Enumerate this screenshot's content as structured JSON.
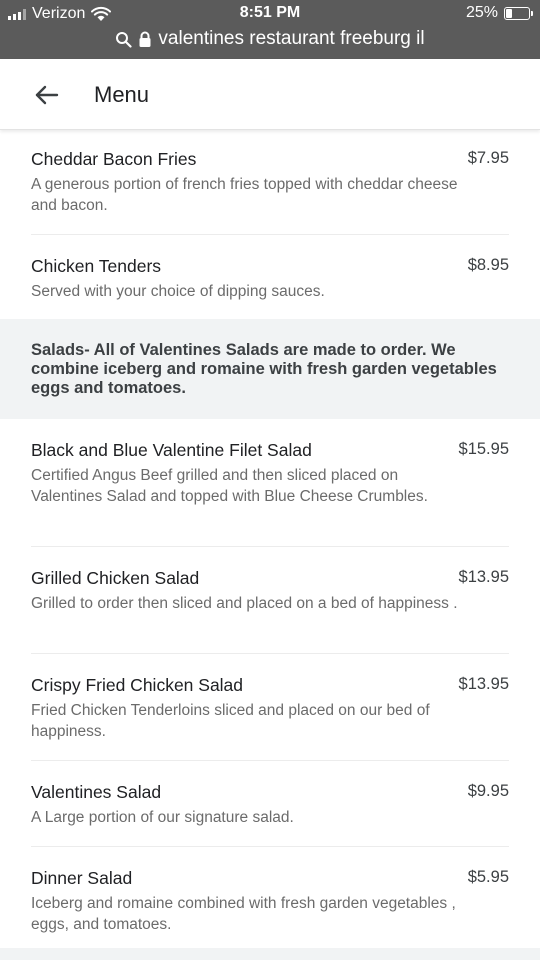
{
  "status_bar": {
    "carrier": "Verizon",
    "time": "8:51 PM",
    "battery": "25%",
    "battery_level": 0.25,
    "url": "valentines restaurant freeburg il"
  },
  "header": {
    "title": "Menu",
    "back_icon": "arrow-left-icon"
  },
  "items_top": [
    {
      "name": "Cheddar Bacon Fries",
      "price": "$7.95",
      "description": "A generous portion of french fries topped with cheddar cheese and bacon."
    },
    {
      "name": "Chicken Tenders",
      "price": "$8.95",
      "description": "Served with your choice of dipping sauces."
    }
  ],
  "section": {
    "title": "Salads- All of Valentines Salads are made to order. We combine iceberg and romaine with fresh garden vegetables eggs and tomatoes."
  },
  "items_salads": [
    {
      "name": "Black and Blue Valentine Filet Salad",
      "price": "$15.95",
      "description": "Certified Angus Beef grilled and then sliced placed on Valentines Salad and topped with Blue Cheese Crumbles."
    },
    {
      "name": "Grilled Chicken Salad",
      "price": "$13.95",
      "description": "Grilled to order then sliced and placed on a bed of happiness ."
    },
    {
      "name": "Crispy Fried Chicken Salad",
      "price": "$13.95",
      "description": "Fried Chicken Tenderloins sliced and placed on our bed of happiness."
    },
    {
      "name": "Valentines Salad",
      "price": "$9.95",
      "description": "A Large portion of our signature salad."
    },
    {
      "name": "Dinner Salad",
      "price": "$5.95",
      "description": "Iceberg and romaine combined with fresh garden vegetables , eggs, and tomatoes."
    }
  ]
}
